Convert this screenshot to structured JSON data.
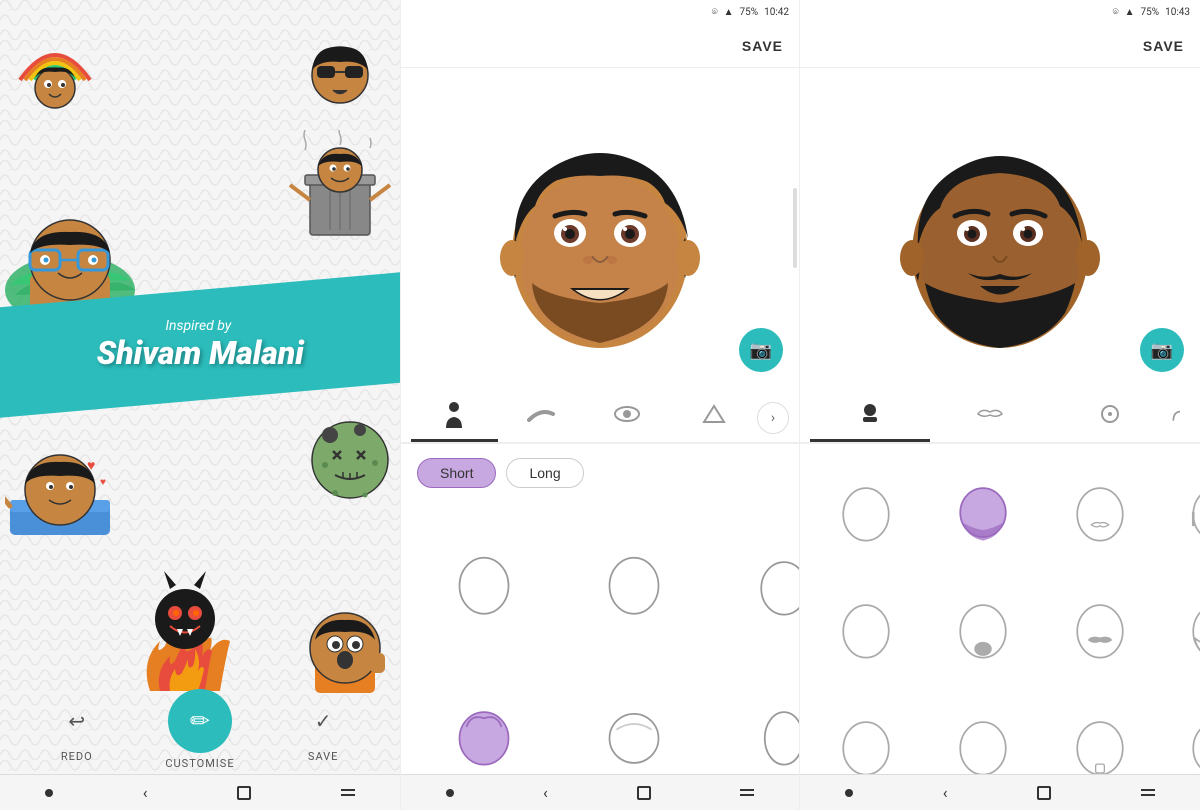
{
  "panel1": {
    "inspired_by": "Inspired by",
    "name": "Shivam Malani",
    "toolbar": {
      "redo_label": "REDO",
      "customise_label": "CUSTOMISE",
      "save_label": "SAVE"
    }
  },
  "panel2": {
    "status": {
      "time": "10:42",
      "battery": "75%"
    },
    "header": {
      "save_label": "SAVE"
    },
    "tabs": [
      {
        "icon": "person",
        "label": "body",
        "active": true
      },
      {
        "icon": "eyebrow",
        "label": "brow"
      },
      {
        "icon": "eye",
        "label": "eye"
      },
      {
        "icon": "hat",
        "label": "hat"
      }
    ],
    "filters": [
      {
        "label": "Short",
        "active": true
      },
      {
        "label": "Long",
        "active": false
      }
    ],
    "shapes": [
      {
        "id": 1,
        "type": "round-narrow"
      },
      {
        "id": 2,
        "type": "round-wide"
      },
      {
        "id": 3,
        "type": "oval"
      },
      {
        "id": 4,
        "type": "oval-narrow"
      },
      {
        "id": 5,
        "type": "selected-purple"
      },
      {
        "id": 6,
        "type": "round-flat"
      },
      {
        "id": 7,
        "type": "narrow"
      },
      {
        "id": 8,
        "type": "wide-oval"
      }
    ]
  },
  "panel3": {
    "status": {
      "time": "10:43",
      "battery": "75%"
    },
    "header": {
      "save_label": "SAVE"
    },
    "tabs": [
      {
        "icon": "hat",
        "label": "hat",
        "active": true
      },
      {
        "icon": "mustache",
        "label": "mustache"
      },
      {
        "icon": "circle",
        "label": "option"
      }
    ],
    "beard_shapes": [
      {
        "id": 1,
        "type": "none",
        "selected": false
      },
      {
        "id": 2,
        "type": "full-purple",
        "selected": true
      },
      {
        "id": 3,
        "type": "none-2",
        "selected": false
      },
      {
        "id": 4,
        "type": "none-3",
        "selected": false
      },
      {
        "id": 5,
        "type": "none-4",
        "selected": false
      },
      {
        "id": 6,
        "type": "goatee-gray",
        "selected": false
      },
      {
        "id": 7,
        "type": "mustache",
        "selected": false
      },
      {
        "id": 8,
        "type": "full-beard",
        "selected": false
      },
      {
        "id": 9,
        "type": "none-5",
        "selected": false
      },
      {
        "id": 10,
        "type": "none-6",
        "selected": false
      },
      {
        "id": 11,
        "type": "none-7",
        "selected": false
      },
      {
        "id": 12,
        "type": "none-8",
        "selected": false
      }
    ]
  },
  "icons": {
    "camera": "📷",
    "person": "👤",
    "redo": "↩",
    "check": "✓",
    "pencil": "✏",
    "back": "‹",
    "forward": "›"
  },
  "colors": {
    "teal": "#2bbcbb",
    "purple_selected": "#c8a8e0",
    "purple_dark": "#9b6abf",
    "gray_border": "#ccc",
    "face_brown": "#c68642",
    "face_dark": "#8B5E3C",
    "hair_black": "#1a1a1a",
    "beard_black": "#1a1a1a"
  }
}
